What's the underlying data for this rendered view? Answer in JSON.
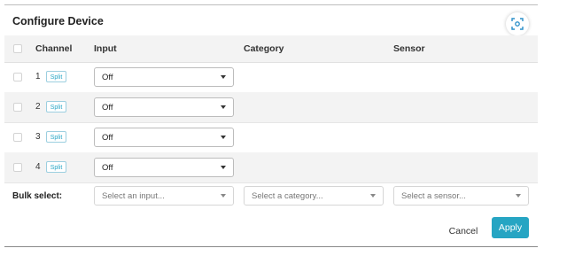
{
  "dialog": {
    "title": "Configure Device",
    "scan_icon": "qr-scan-icon"
  },
  "table": {
    "headers": {
      "channel": "Channel",
      "input": "Input",
      "category": "Category",
      "sensor": "Sensor"
    },
    "rows": [
      {
        "channel": "1",
        "split_label": "Split",
        "input": "Off",
        "category": "",
        "sensor": ""
      },
      {
        "channel": "2",
        "split_label": "Split",
        "input": "Off",
        "category": "",
        "sensor": ""
      },
      {
        "channel": "3",
        "split_label": "Split",
        "input": "Off",
        "category": "",
        "sensor": ""
      },
      {
        "channel": "4",
        "split_label": "Split",
        "input": "Off",
        "category": "",
        "sensor": ""
      }
    ]
  },
  "bulk": {
    "label": "Bulk select:",
    "input_placeholder": "Select an input...",
    "category_placeholder": "Select a category...",
    "sensor_placeholder": "Select a sensor..."
  },
  "footer": {
    "cancel_label": "Cancel",
    "apply_label": "Apply"
  },
  "colors": {
    "accent": "#26a5c3",
    "header_bg": "#f3f3f3"
  }
}
